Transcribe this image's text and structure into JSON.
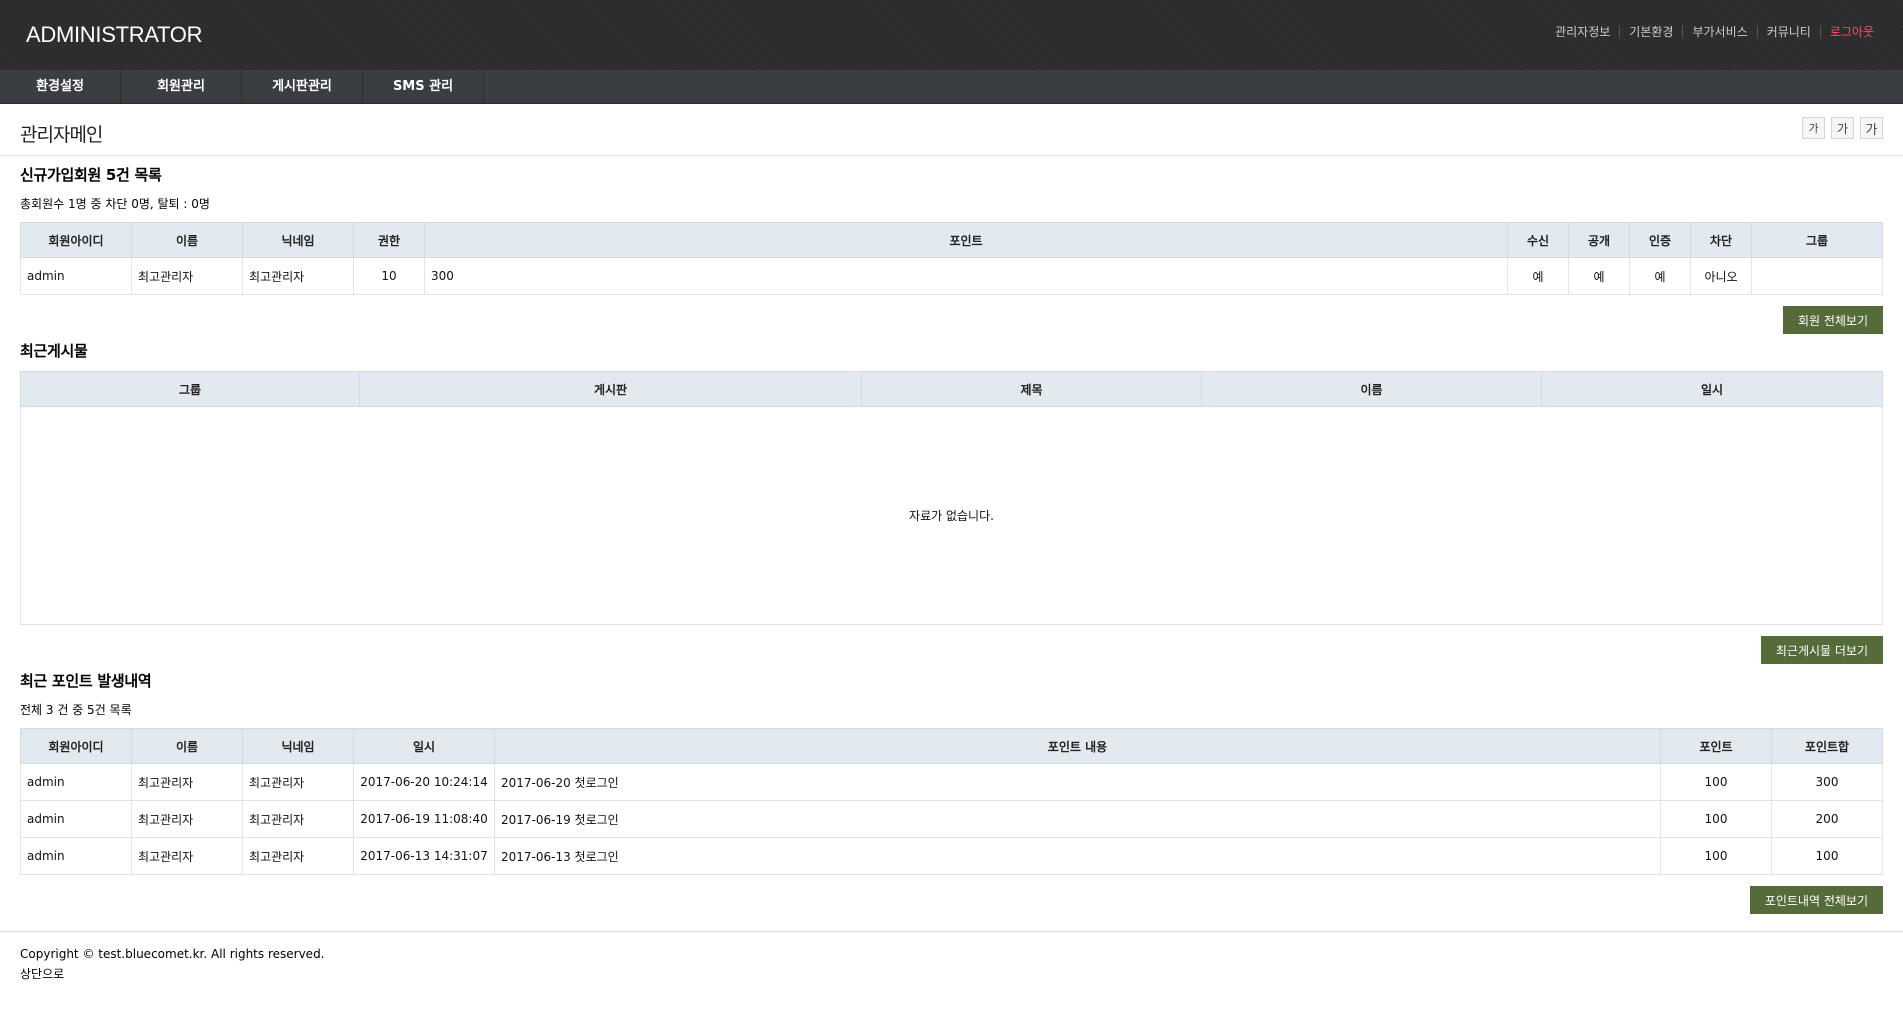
{
  "header": {
    "logo": "ADMINISTRATOR",
    "links": [
      "관리자정보",
      "기본환경",
      "부가서비스",
      "커뮤니티"
    ],
    "logout": "로그아웃"
  },
  "gnb": [
    "환경설정",
    "회원관리",
    "게시판관리",
    "SMS 관리"
  ],
  "page": {
    "title": "관리자메인",
    "font_buttons": [
      "가",
      "가",
      "가"
    ]
  },
  "members": {
    "title": "신규가입회원 5건 목록",
    "summary": "총회원수 1명 중 차단 0명, 탈퇴 : 0명",
    "headers": [
      "회원아이디",
      "이름",
      "닉네임",
      "권한",
      "포인트",
      "수신",
      "공개",
      "인증",
      "차단",
      "그룹"
    ],
    "rows": [
      [
        "admin",
        "최고관리자",
        "최고관리자",
        "10",
        "300",
        "예",
        "예",
        "예",
        "아니오",
        ""
      ]
    ],
    "button": "회원 전체보기"
  },
  "posts": {
    "title": "최근게시물",
    "headers": [
      "그룹",
      "게시판",
      "제목",
      "이름",
      "일시"
    ],
    "empty": "자료가 없습니다.",
    "button": "최근게시물 더보기"
  },
  "points": {
    "title": "최근 포인트 발생내역",
    "summary": "전체 3 건 중 5건 목록",
    "headers": [
      "회원아이디",
      "이름",
      "닉네임",
      "일시",
      "포인트 내용",
      "포인트",
      "포인트합"
    ],
    "rows": [
      [
        "admin",
        "최고관리자",
        "최고관리자",
        "2017-06-20 10:24:14",
        "2017-06-20 첫로그인",
        "100",
        "300"
      ],
      [
        "admin",
        "최고관리자",
        "최고관리자",
        "2017-06-19 11:08:40",
        "2017-06-19 첫로그인",
        "100",
        "200"
      ],
      [
        "admin",
        "최고관리자",
        "최고관리자",
        "2017-06-13 14:31:07",
        "2017-06-13 첫로그인",
        "100",
        "100"
      ]
    ],
    "button": "포인트내역 전체보기"
  },
  "footer": {
    "copyright": "Copyright © test.bluecomet.kr. All rights reserved.",
    "top": "상단으로"
  }
}
